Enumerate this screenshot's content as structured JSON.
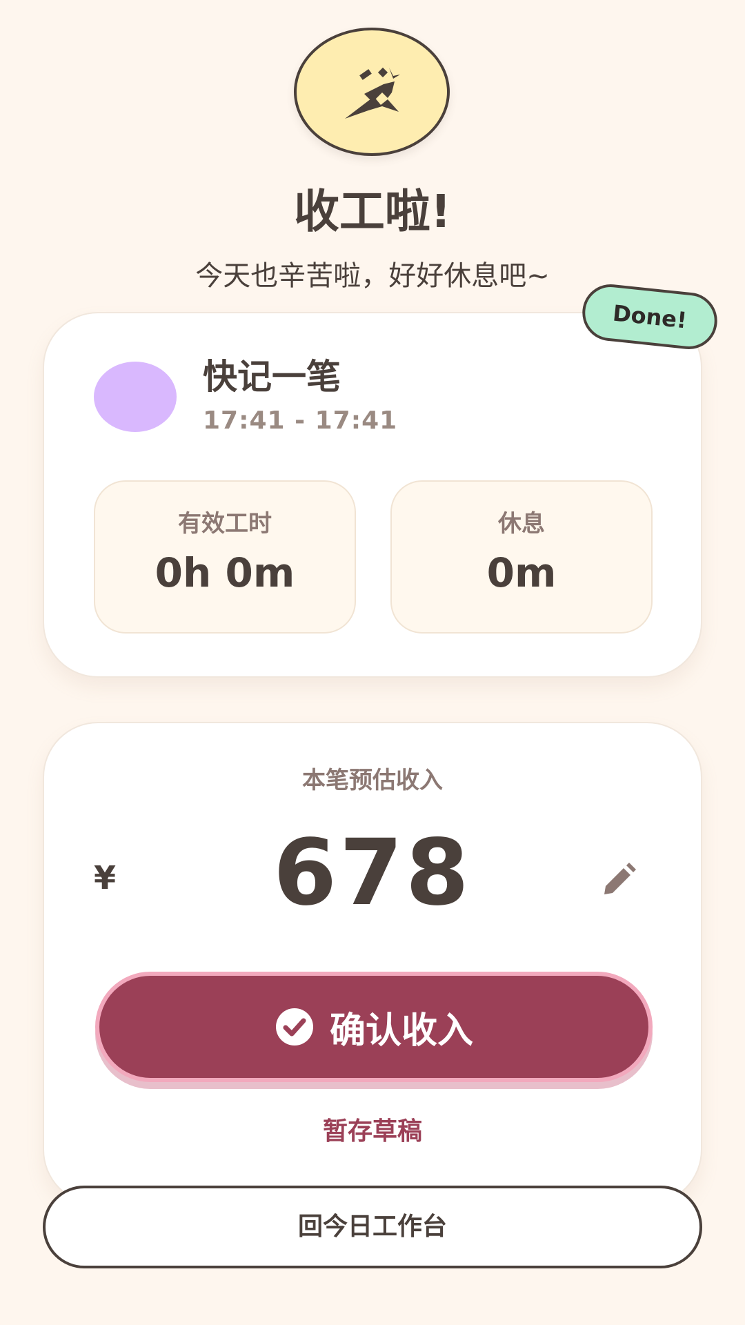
{
  "header": {
    "title": "收工啦!",
    "subtitle": "今天也辛苦啦，好好休息吧~",
    "icon": "mountain-sparkle-icon"
  },
  "badge": {
    "label": "Done!"
  },
  "session": {
    "name": "快记一笔",
    "time_range": "17:41 - 17:41",
    "dot_color": "#D9B8FE",
    "stats": [
      {
        "label": "有效工时",
        "value": "0h 0m"
      },
      {
        "label": "休息",
        "value": "0m"
      }
    ]
  },
  "income": {
    "label": "本笔预估收入",
    "currency": "¥",
    "amount": "678",
    "confirm_label": "确认收入",
    "draft_label": "暂存草稿"
  },
  "footer": {
    "back_label": "回今日工作台"
  },
  "colors": {
    "background": "#FEF6EE",
    "accent": "#9B4057",
    "badge": "#B2EDD0",
    "header_circle": "#FEEDB0"
  }
}
